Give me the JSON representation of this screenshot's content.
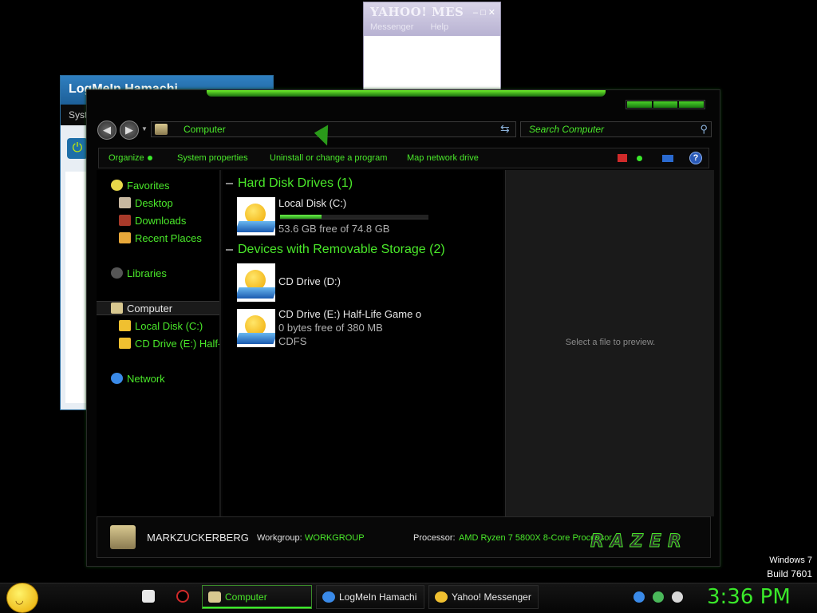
{
  "yahoo_window": {
    "title": "YAHOO! MES",
    "menu": [
      "Messenger",
      "Help"
    ]
  },
  "hamachi_window": {
    "title": "LogMeIn Hamachi",
    "menu_partial": "Syst"
  },
  "explorer": {
    "address": "Computer",
    "search_placeholder": "Search Computer",
    "toolbar": {
      "organize": "Organize",
      "system_properties": "System properties",
      "uninstall": "Uninstall or change a program",
      "map_drive": "Map network drive"
    },
    "nav": {
      "favorites": "Favorites",
      "desktop": "Desktop",
      "downloads": "Downloads",
      "recent_places": "Recent Places",
      "libraries": "Libraries",
      "computer": "Computer",
      "local_disk": "Local Disk (C:)",
      "cd_drive_e": "CD Drive (E:) Half-",
      "network": "Network"
    },
    "groups": {
      "hard_disks": "Hard Disk Drives (1)",
      "removable": "Devices with Removable Storage (2)"
    },
    "drives": [
      {
        "name": "Local Disk (C:)",
        "free": "53.6 GB free of 74.8 GB",
        "used_fraction": 0.28
      },
      {
        "name": "CD Drive (D:)"
      },
      {
        "name": "CD Drive (E:) Half-Life Game o",
        "free": "0 bytes free of 380 MB",
        "fs": "CDFS"
      }
    ],
    "preview_text": "Select a file to preview.",
    "details": {
      "computer_name": "MARKZUCKERBERG",
      "workgroup_label": "Workgroup:",
      "workgroup": "WORKGROUP",
      "processor_label": "Processor:",
      "processor": "AMD Ryzen 7 5800X 8-Core Processor",
      "logo": "RAZER"
    }
  },
  "windows_build": {
    "line1": "Windows 7",
    "line2": "Build 7601"
  },
  "taskbar": {
    "tasks": [
      "Computer",
      "LogMeIn Hamachi",
      "Yahoo! Messenger"
    ],
    "clock": "3:36 PM"
  },
  "colors": {
    "accent": "#3ae82a",
    "background": "#000000"
  }
}
